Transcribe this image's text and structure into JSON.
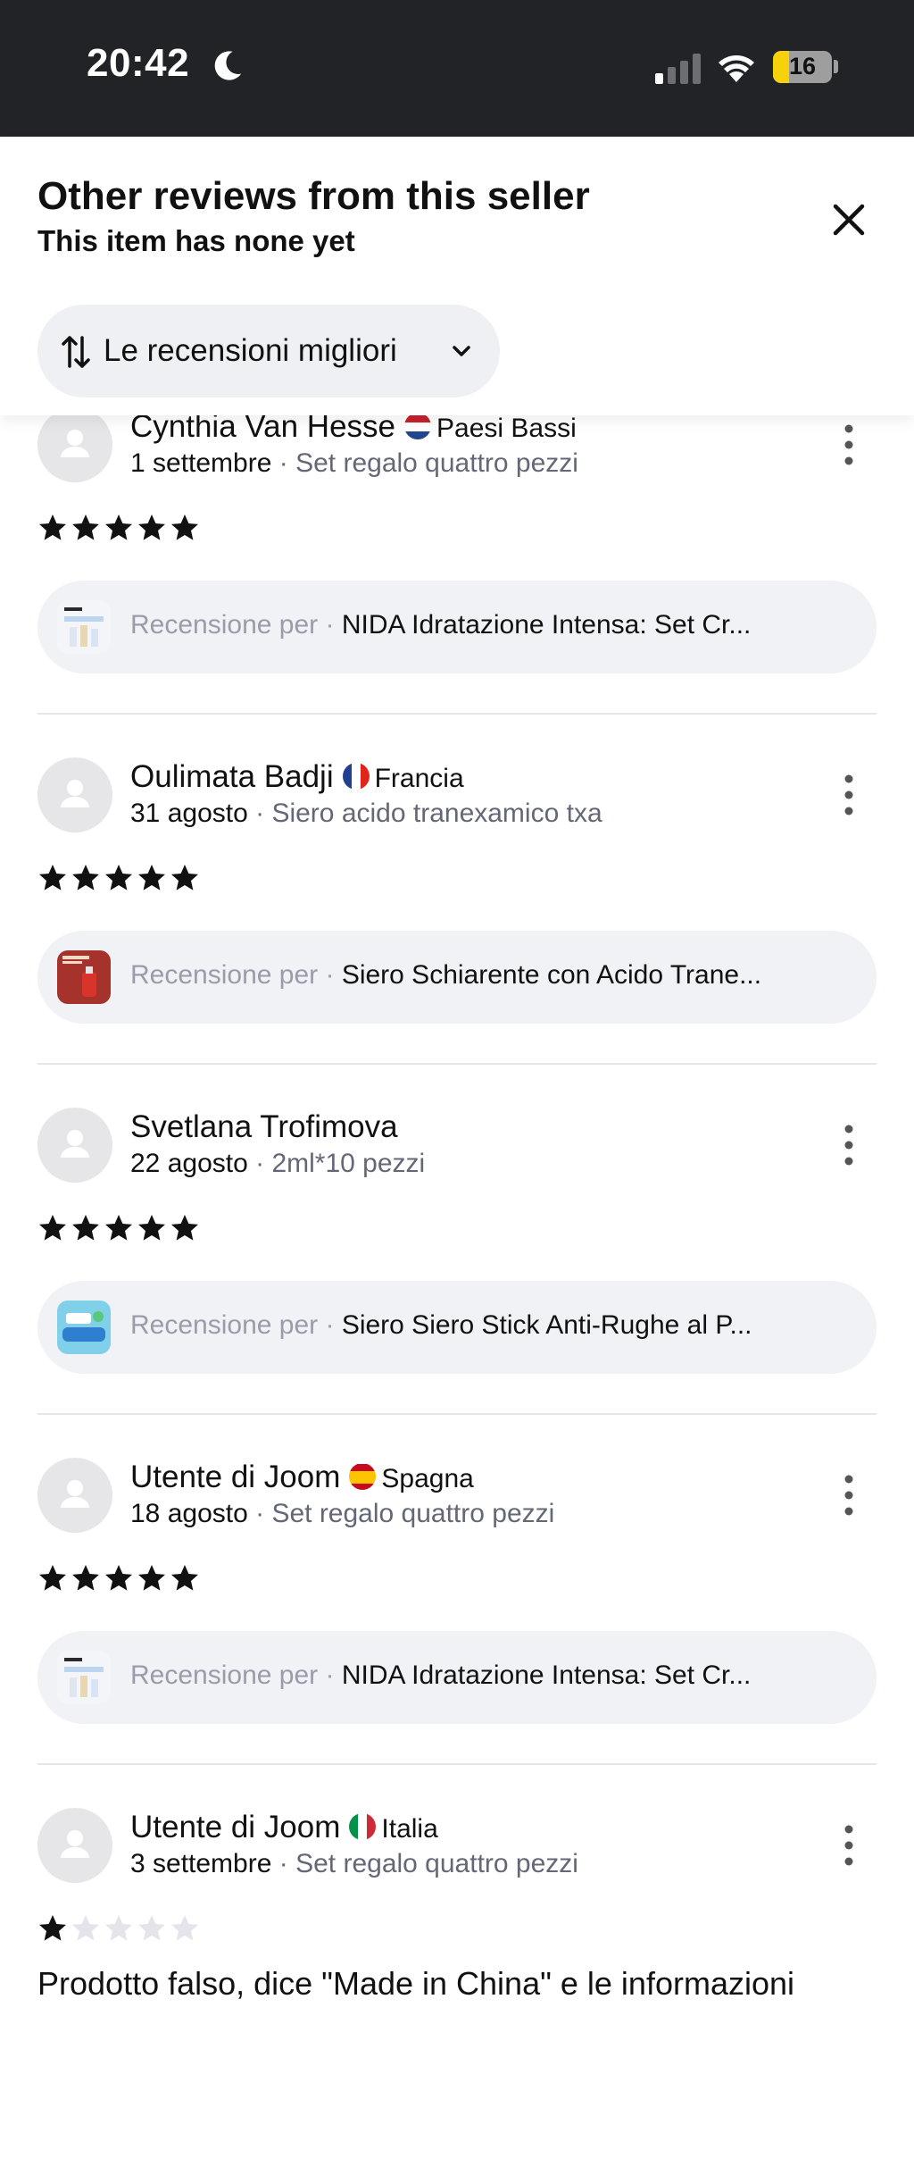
{
  "status_bar": {
    "time": "20:42",
    "battery": "16"
  },
  "header": {
    "title": "Other reviews from this seller",
    "subtitle": "This item has none yet",
    "sort_label": "Le recensioni migliori"
  },
  "colors": {
    "status_bar_bg": "#222327",
    "pill_bg": "#f1f2f6",
    "muted_text": "#646876",
    "battery_fill": "#f7d20b"
  },
  "review_prefix": "Recensione per ·",
  "reviews": [
    {
      "name": "Cynthia Van Hesse",
      "country": "Paesi Bassi",
      "flag": "netherlands-flag",
      "date": "1 settembre",
      "variant": "· Set regalo quattro pezzi",
      "rating": 5,
      "product": "NIDA Idratazione Intensa: Set Cr..."
    },
    {
      "name": "Oulimata Badji",
      "country": "Francia",
      "flag": "france-flag",
      "date": "31 agosto",
      "variant": "· Siero acido tranexamico txa",
      "rating": 5,
      "product": "Siero Schiarente con Acido Trane..."
    },
    {
      "name": "Svetlana Trofimova",
      "country": "",
      "flag": "",
      "date": "22 agosto",
      "variant": "· 2ml*10 pezzi",
      "rating": 5,
      "product": "Siero Siero Stick Anti-Rughe al P..."
    },
    {
      "name": "Utente di Joom",
      "country": "Spagna",
      "flag": "spain-flag",
      "date": "18 agosto",
      "variant": "· Set regalo quattro pezzi",
      "rating": 5,
      "product": "NIDA Idratazione Intensa: Set Cr..."
    },
    {
      "name": "Utente di Joom",
      "country": "Italia",
      "flag": "italy-flag",
      "date": "3 settembre",
      "variant": "· Set regalo quattro pezzi",
      "rating": 1,
      "product": ""
    }
  ],
  "cut_off_text": "Prodotto falso, dice \"Made in China\" e le informazioni"
}
